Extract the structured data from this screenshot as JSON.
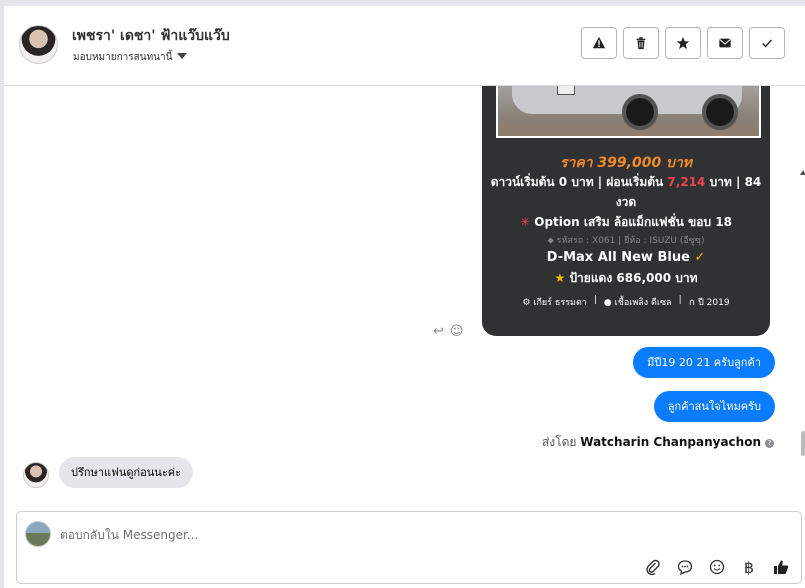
{
  "header": {
    "contact_name": "เพชรา' เดชา' ฟ้าแว๊บแว๊บ",
    "assign_label": "มอบหมายการสนทนานี้",
    "actions": [
      {
        "name": "report-spam-button",
        "icon": "warning-icon"
      },
      {
        "name": "delete-button",
        "icon": "trash-icon"
      },
      {
        "name": "mark-star-button",
        "icon": "star-icon"
      },
      {
        "name": "mark-unread-button",
        "icon": "envelope-icon"
      },
      {
        "name": "mark-done-button",
        "icon": "check-icon"
      }
    ]
  },
  "card": {
    "price": "ราคา 399,000 บาท",
    "down_prefix": "ดาวน์เริ่มต้น 0 บาท | ผ่อนเริ่มต้น",
    "down_installment": "7,214",
    "down_suffix": "บาท | 84 งวด",
    "option": "Option เสริม ล้อแม็กแฟชั่น ขอบ 18",
    "meta": "รหัสรถ : X061 | ยี่ห้อ : ISUZU (อีซูซุ)",
    "model": "D-Max All New Blue",
    "red_plate": "ป้ายแดง 686,000 บาท",
    "spec_gear": "เกียร์ ธรรมดา",
    "spec_fuel": "เชื้อเพลิง ดีเซล",
    "spec_year": "ปี 2019"
  },
  "messages": {
    "outgoing_1": "มีปี19 20 21 ครับลูกค้า",
    "outgoing_2": "ลูกค้าสนใจไหมครับ",
    "sent_by_label": "ส่งโดย",
    "sent_by_name": "Watcharin Chanpanyachon",
    "incoming_1": "ปรึกษาแฟนดูก่อนนะค่ะ"
  },
  "composer": {
    "placeholder": "ตอบกลับใน Messenger...",
    "tools": [
      "paperclip-icon",
      "chat-bubble-icon",
      "emoji-icon",
      "baht-icon",
      "thumbs-up-icon"
    ]
  },
  "colors": {
    "bubble_blue": "#0a7cff",
    "card_bg": "#2f3132",
    "price_orange": "#f18b2a",
    "installment_red": "#f0424f"
  }
}
